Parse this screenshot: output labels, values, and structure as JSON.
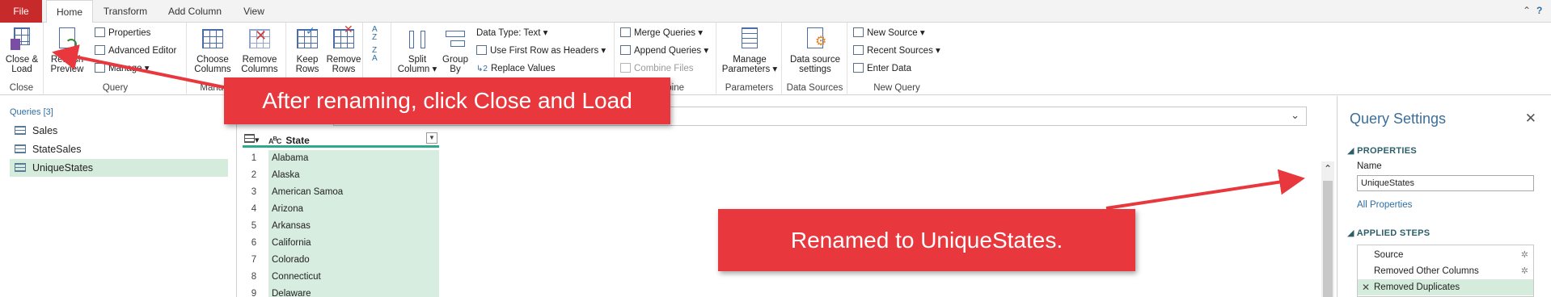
{
  "tabs": {
    "file": "File",
    "home": "Home",
    "transform": "Transform",
    "add_column": "Add Column",
    "view": "View"
  },
  "ribbon": {
    "close": {
      "btn": "Close &",
      "btn2": "Load",
      "label": "Close"
    },
    "query": {
      "refresh": "Refresh",
      "refresh2": "Preview",
      "properties": "Properties",
      "advanced_editor": "Advanced Editor",
      "manage": "Manage",
      "label": "Query"
    },
    "manage_cols": {
      "choose": "Choose",
      "choose2": "Columns",
      "remove": "Remove",
      "remove2": "Columns",
      "label": "Manage Columns"
    },
    "reduce_rows": {
      "keep": "Keep",
      "keep2": "Rows",
      "remove": "Remove",
      "remove2": "Rows"
    },
    "transform": {
      "split": "Split",
      "split2": "Column",
      "group": "Group",
      "group2": "By",
      "data_type": "Data Type: Text",
      "first_row": "Use First Row as Headers",
      "replace": "Replace Values"
    },
    "combine": {
      "merge": "Merge Queries",
      "append": "Append Queries",
      "combine_files": "Combine Files",
      "label": "Combine"
    },
    "parameters": {
      "manage": "Manage",
      "manage2": "Parameters",
      "label": "Parameters"
    },
    "data_sources": {
      "btn": "Data source",
      "btn2": "settings",
      "label": "Data Sources"
    },
    "new_query": {
      "new_source": "New Source",
      "recent_sources": "Recent Sources",
      "enter_data": "Enter Data",
      "label": "New Query"
    }
  },
  "queries": {
    "header": "Queries [3]",
    "items": [
      "Sales",
      "StateSales",
      "UniqueStates"
    ]
  },
  "table": {
    "column": "State",
    "rows": [
      {
        "n": "1",
        "v": "Alabama"
      },
      {
        "n": "2",
        "v": "Alaska"
      },
      {
        "n": "3",
        "v": "American Samoa"
      },
      {
        "n": "4",
        "v": "Arizona"
      },
      {
        "n": "5",
        "v": "Arkansas"
      },
      {
        "n": "6",
        "v": "California"
      },
      {
        "n": "7",
        "v": "Colorado"
      },
      {
        "n": "8",
        "v": "Connecticut"
      },
      {
        "n": "9",
        "v": "Delaware"
      }
    ]
  },
  "settings": {
    "title": "Query Settings",
    "properties": "PROPERTIES",
    "name_label": "Name",
    "name_value": "UniqueStates",
    "all_properties": "All Properties",
    "applied_steps": "APPLIED STEPS",
    "steps": [
      "Source",
      "Removed Other Columns",
      "Removed Duplicates"
    ]
  },
  "callouts": {
    "left": "After renaming, click Close and Load",
    "right": "Renamed to UniqueStates."
  },
  "colors": {
    "accent_red": "#e8383d",
    "file_tab": "#c72a2a",
    "selection": "#d5ebdc",
    "header_line": "#2fa98c"
  }
}
